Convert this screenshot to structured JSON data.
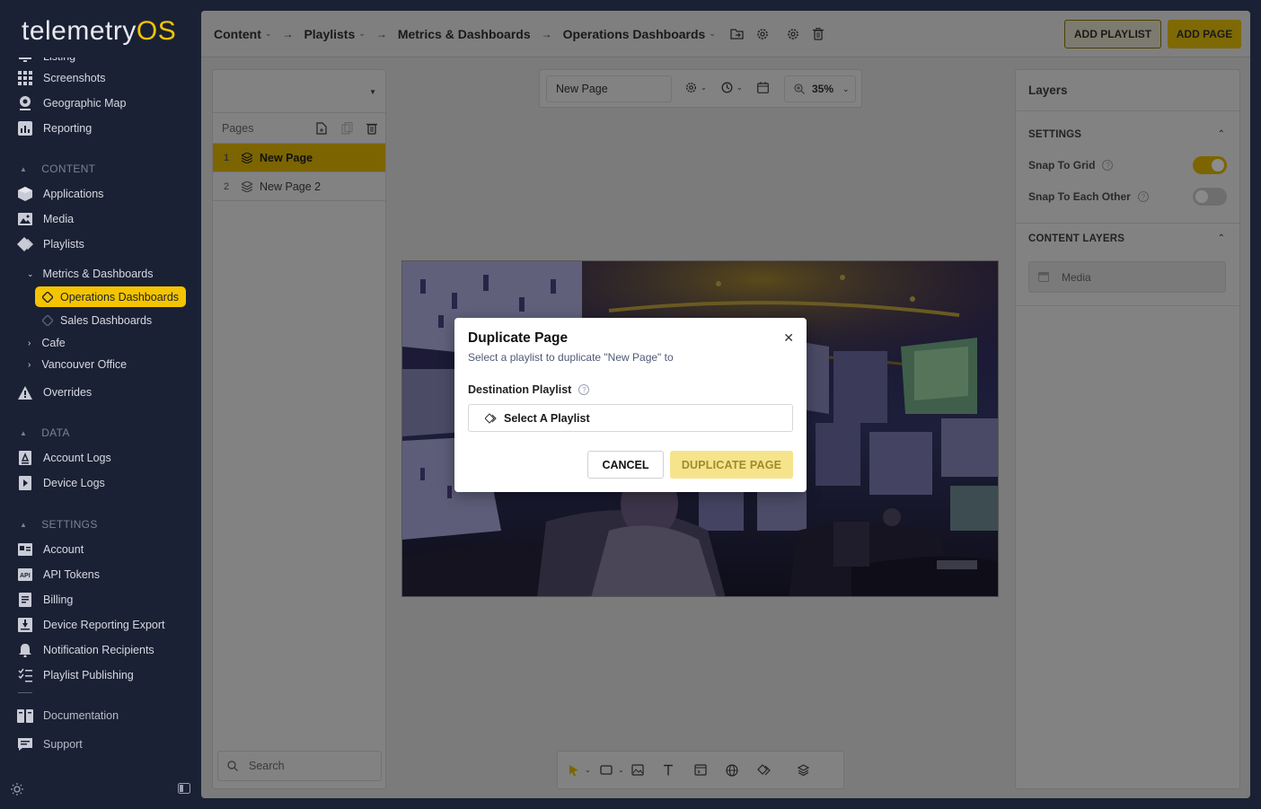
{
  "app": {
    "logo_main": "telemetry",
    "logo_accent": "OS"
  },
  "sidebar": {
    "cut_item": "Listing",
    "items_top": [
      {
        "label": "Screenshots",
        "icon": "grid-icon"
      },
      {
        "label": "Geographic Map",
        "icon": "map-pin-icon"
      },
      {
        "label": "Reporting",
        "icon": "chart-icon"
      }
    ],
    "content_section": "CONTENT",
    "content_items": [
      {
        "label": "Applications",
        "icon": "cube-icon"
      },
      {
        "label": "Media",
        "icon": "image-icon"
      },
      {
        "label": "Playlists",
        "icon": "playlist-icon"
      }
    ],
    "folder_metrics": "Metrics & Dashboards",
    "active_playlist": "Operations Dashboards",
    "sub_sales": "Sales Dashboards",
    "folder_cafe": "Cafe",
    "folder_vancouver": "Vancouver Office",
    "overrides": "Overrides",
    "data_section": "DATA",
    "data_items": [
      {
        "label": "Account Logs"
      },
      {
        "label": "Device Logs"
      }
    ],
    "settings_section": "SETTINGS",
    "settings_items": [
      {
        "label": "Account"
      },
      {
        "label": "API Tokens"
      },
      {
        "label": "Billing"
      },
      {
        "label": "Device Reporting Export"
      },
      {
        "label": "Notification Recipients"
      },
      {
        "label": "Playlist Publishing"
      }
    ],
    "documentation": "Documentation",
    "support": "Support"
  },
  "topbar": {
    "crumbs": [
      "Content",
      "Playlists",
      "Metrics & Dashboards",
      "Operations Dashboards"
    ],
    "add_playlist": "ADD PLAYLIST",
    "add_page": "ADD PAGE"
  },
  "pages_panel": {
    "heading": "Pages",
    "pages": [
      {
        "num": "1",
        "name": "New Page"
      },
      {
        "num": "2",
        "name": "New Page 2"
      }
    ],
    "search_placeholder": "Search"
  },
  "editor": {
    "page_name": "New Page",
    "zoom": "35%"
  },
  "layers": {
    "title": "Layers",
    "settings_heading": "SETTINGS",
    "snap_grid": "Snap To Grid",
    "snap_grid_on": true,
    "snap_each": "Snap To Each Other",
    "snap_each_on": false,
    "content_layers_heading": "CONTENT LAYERS",
    "media_layer": "Media"
  },
  "modal": {
    "title": "Duplicate Page",
    "subtitle": "Select a playlist to duplicate \"New Page\" to",
    "label": "Destination Playlist",
    "select_placeholder": "Select A Playlist",
    "cancel": "CANCEL",
    "duplicate": "DUPLICATE PAGE"
  },
  "colors": {
    "accent": "#f4c400",
    "sidebar_bg": "#1b2134"
  }
}
